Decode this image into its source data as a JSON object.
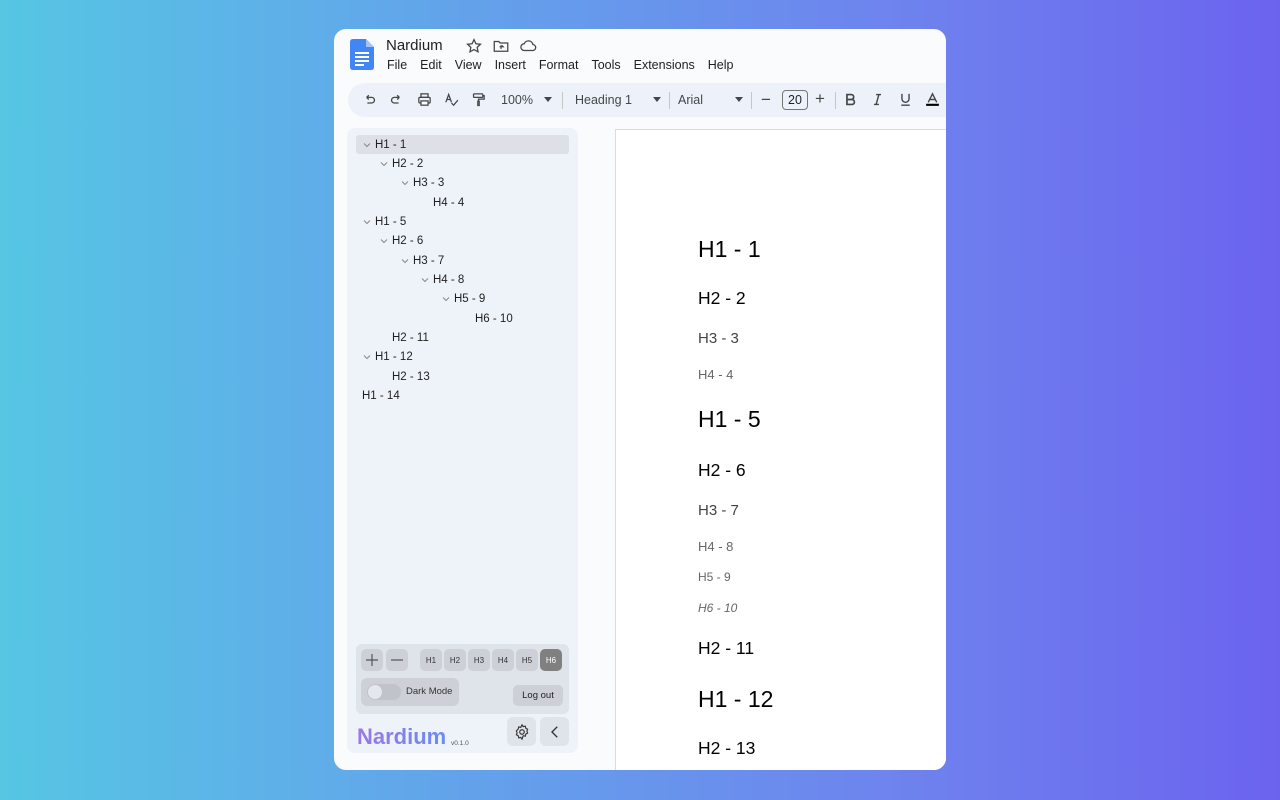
{
  "app": {
    "title": "Nardium",
    "menu": [
      "File",
      "Edit",
      "View",
      "Insert",
      "Format",
      "Tools",
      "Extensions",
      "Help"
    ]
  },
  "toolbar": {
    "zoom": "100%",
    "style": "Heading 1",
    "font": "Arial",
    "font_size": "20",
    "decrease": "−",
    "increase": "+"
  },
  "outline": [
    {
      "label": "H1 - 1",
      "level": 1,
      "chevron": true,
      "selected": true
    },
    {
      "label": "H2 - 2",
      "level": 2,
      "chevron": true
    },
    {
      "label": "H3 - 3",
      "level": 3,
      "chevron": true
    },
    {
      "label": "H4 - 4",
      "level": 4,
      "chevron": false
    },
    {
      "label": "H1 - 5",
      "level": 1,
      "chevron": true
    },
    {
      "label": "H2 - 6",
      "level": 2,
      "chevron": true
    },
    {
      "label": "H3 - 7",
      "level": 3,
      "chevron": true
    },
    {
      "label": "H4 - 8",
      "level": 4,
      "chevron": true
    },
    {
      "label": "H5 - 9",
      "level": 5,
      "chevron": true
    },
    {
      "label": "H6 - 10",
      "level": 6,
      "chevron": false
    },
    {
      "label": "H2 - 11",
      "level": 2,
      "chevron": false
    },
    {
      "label": "H1 - 12",
      "level": 1,
      "chevron": true
    },
    {
      "label": "H2 - 13",
      "level": 2,
      "chevron": false
    },
    {
      "label": "H1 - 14",
      "level": 1,
      "chevron": false
    }
  ],
  "panel": {
    "levels": [
      "H1",
      "H2",
      "H3",
      "H4",
      "H5",
      "H6"
    ],
    "active_level": "H6",
    "dark_mode_label": "Dark Mode",
    "logout_label": "Log out"
  },
  "brand": {
    "name": "Nardium",
    "version": "v0.1.0"
  },
  "document": {
    "headings": [
      {
        "text": "H1 - 1",
        "level": 1
      },
      {
        "text": "H2 - 2",
        "level": 2
      },
      {
        "text": "H3 - 3",
        "level": 3
      },
      {
        "text": "H4 - 4",
        "level": 4
      },
      {
        "text": "H1 - 5",
        "level": 1
      },
      {
        "text": "H2 - 6",
        "level": 2
      },
      {
        "text": "H3 - 7",
        "level": 3
      },
      {
        "text": "H4 - 8",
        "level": 4
      },
      {
        "text": "H5 - 9",
        "level": 5
      },
      {
        "text": "H6 - 10",
        "level": 6
      },
      {
        "text": "H2 - 11",
        "level": 2
      },
      {
        "text": "H1 - 12",
        "level": 1
      },
      {
        "text": "H2 - 13",
        "level": 2
      }
    ]
  }
}
